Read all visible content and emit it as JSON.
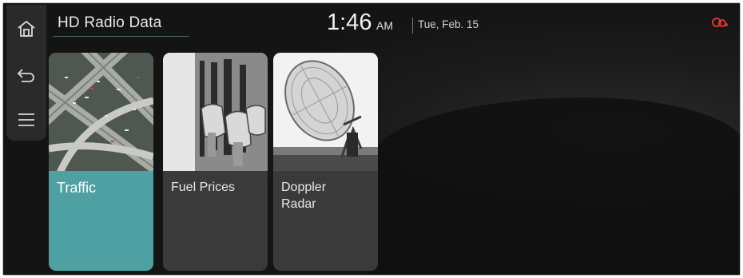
{
  "header": {
    "title": "HD Radio Data",
    "time": "1:46",
    "ampm": "AM",
    "date": "Tue, Feb. 15"
  },
  "sidebar": {
    "items": [
      {
        "icon": "home-icon"
      },
      {
        "icon": "back-icon"
      },
      {
        "icon": "menu-icon"
      }
    ]
  },
  "status": {
    "icon": "connected-car-icon",
    "color": "#e0342c"
  },
  "cards": [
    {
      "label": "Traffic",
      "image": "highway-aerial-image",
      "selected": true,
      "accent": "#4ea0a2"
    },
    {
      "label": "Fuel Prices",
      "image": "fuel-pump-image"
    },
    {
      "label_lines": [
        "Doppler",
        "Radar"
      ],
      "image": "radar-dish-image"
    }
  ]
}
